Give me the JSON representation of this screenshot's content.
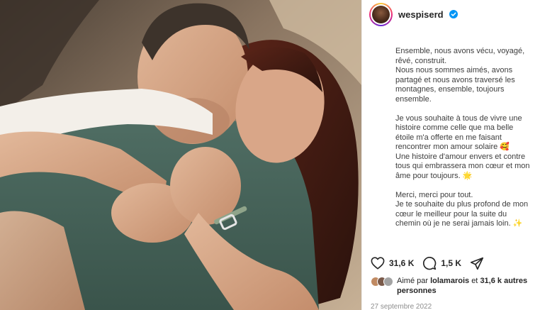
{
  "post": {
    "username": "wespiserd",
    "caption_paragraphs": [
      [
        "Ensemble, nous avons vécu, voyagé,",
        "rêvé, construit.",
        "Nous nous sommes aimés, avons",
        "partagé et nous avons traversé les",
        "montagnes, ensemble, toujours",
        "ensemble."
      ],
      [
        "Je vous souhaite à tous de vivre une",
        "histoire comme celle que ma belle",
        "étoile m'a offerte en me faisant",
        "rencontrer mon amour solaire 🥰",
        "Une histoire d'amour envers et contre",
        "tous qui embrassera mon cœur et mon",
        "âme pour toujours. 🌟"
      ],
      [
        "Merci, merci pour tout.",
        "Je te souhaite du plus profond de mon",
        "cœur le meilleur pour la suite du",
        "chemin où je ne serai jamais loin. ✨"
      ]
    ],
    "likes": "31,6 K",
    "comments": "1,5 K",
    "liked_by_prefix": "Aimé par",
    "liked_by_user": "lolamarois",
    "liked_by_middle": "et",
    "liked_by_others": "31,6 k autres personnes",
    "date": "27 septembre 2022"
  },
  "icons": {
    "verified": "verified-badge-icon",
    "like": "heart-icon",
    "comment": "comment-bubble-icon",
    "share": "paper-plane-icon"
  },
  "colors": {
    "verified_blue": "#0095f6",
    "text": "#262626",
    "muted": "#8e8e8e"
  }
}
